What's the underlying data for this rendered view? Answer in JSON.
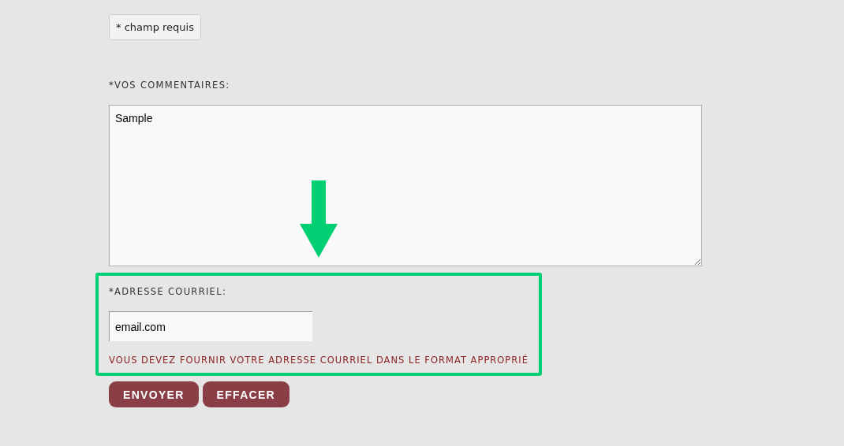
{
  "required_note": "* champ requis",
  "comments": {
    "label": "*VOS COMMENTAIRES:",
    "value": "Sample"
  },
  "email": {
    "label": "*ADRESSE COURRIEL:",
    "value": "email.com",
    "error": "VOUS DEVEZ FOURNIR VOTRE ADRESSE COURRIEL DANS LE FORMAT APPROPRIÉ"
  },
  "buttons": [
    "ENVOYER",
    "EFFACER"
  ]
}
